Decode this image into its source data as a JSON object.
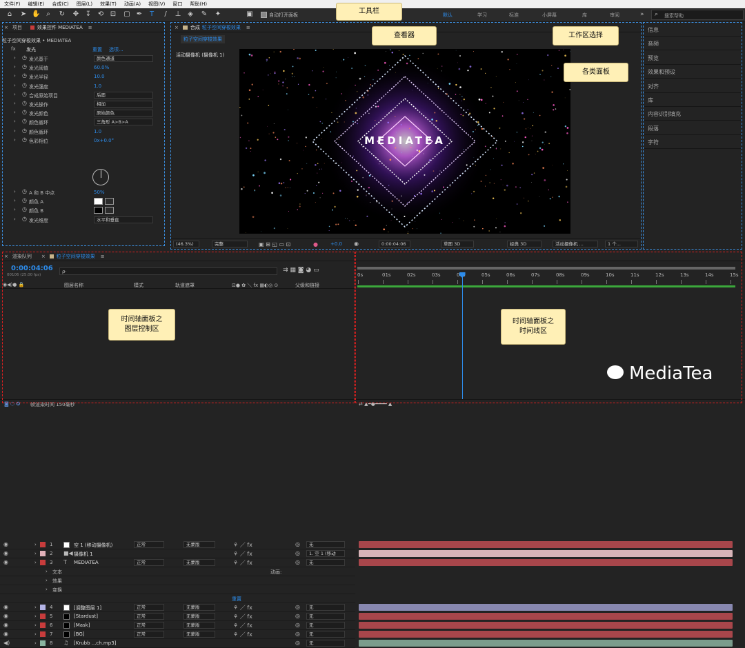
{
  "menu": [
    "文件(F)",
    "编辑(E)",
    "合成(C)",
    "图层(L)",
    "效果(T)",
    "动画(A)",
    "视图(V)",
    "窗口",
    "帮助(H)"
  ],
  "toolbar": {
    "auto_open": "自动打开面板",
    "search_placeholder": "搜索帮助"
  },
  "workspaces": [
    "默认",
    "学习",
    "标准",
    "小屏幕",
    "库",
    "审阅"
  ],
  "workspace_more": "»",
  "callouts": {
    "toolbar": "工具栏",
    "viewer": "查看器",
    "workspace": "工作区选择",
    "panels": "各类面板",
    "layer_ctrl": "时间轴面板之\n图层控制区",
    "timeline": "时间轴面板之\n时间线区"
  },
  "effects": {
    "tab_project": "项目",
    "tab_effects": "效果控件 MEDIATEA",
    "breadcrumb": "粒子空间穿梭效果 • MEDIATEA",
    "glow": {
      "name": "发光",
      "reset": "重置",
      "options": "选项..."
    },
    "rows": [
      {
        "label": "发光基于",
        "value": "颜色通道",
        "kind": "select"
      },
      {
        "label": "发光阈值",
        "value": "60.0%",
        "kind": "num"
      },
      {
        "label": "发光半径",
        "value": "10.0",
        "kind": "num"
      },
      {
        "label": "发光强度",
        "value": "1.0",
        "kind": "num"
      },
      {
        "label": "合成原始项目",
        "value": "后面",
        "kind": "select"
      },
      {
        "label": "发光操作",
        "value": "相加",
        "kind": "select"
      },
      {
        "label": "发光颜色",
        "value": "原始颜色",
        "kind": "select"
      },
      {
        "label": "颜色循环",
        "value": "三角形 A>B>A",
        "kind": "select"
      },
      {
        "label": "颜色循环",
        "value": "1.0",
        "kind": "num"
      },
      {
        "label": "色彩相位",
        "value": "0x+0.0°",
        "kind": "num"
      }
    ],
    "rows2": [
      {
        "label": "A 和 B 中点",
        "value": "50%",
        "kind": "num"
      },
      {
        "label": "颜色 A",
        "value": "",
        "kind": "swatch-white"
      },
      {
        "label": "颜色 B",
        "value": "",
        "kind": "swatch-black"
      },
      {
        "label": "发光维度",
        "value": "水平和垂直",
        "kind": "select"
      }
    ]
  },
  "viewer": {
    "tab": "合成",
    "comp_name": "粒子空间穿梭效果",
    "breadcrumb": "粒子空间穿梭效果",
    "camera_label": "活动摄像机 (摄像机 1)",
    "center_text": "MEDIATEA",
    "zoom": "(46.3%)",
    "quality": "完整",
    "exposure": "+0.0",
    "timecode": "0:00:04:06",
    "draft": "草图 3D",
    "renderer": "经典 3D",
    "camera": "活动摄像机 ...",
    "views": "1 个..."
  },
  "right_panels": [
    "信息",
    "音频",
    "预览",
    "效果和预设",
    "对齐",
    "库",
    "内容识别填充",
    "段落",
    "字符"
  ],
  "timeline": {
    "tab_render": "渲染队列",
    "tab_comp": "粒子空间穿梭效果",
    "timecode": "0:00:04:06",
    "frames": "00106 (25.00 fps)",
    "search_placeholder": "ρ·",
    "col_name": "图层名称",
    "col_mode": "模式",
    "col_track": "轨道遮罩",
    "col_parent": "父级和链接",
    "ruler": [
      "0s",
      "01s",
      "02s",
      "03s",
      "04s",
      "05s",
      "06s",
      "07s",
      "08s",
      "09s",
      "10s",
      "11s",
      "12s",
      "13s",
      "14s",
      "15s"
    ],
    "playhead_fraction": 0.2806,
    "layers": [
      {
        "num": "1",
        "name": "空 1 (移动摄像机)",
        "mode": "正常",
        "track": "无蒙版",
        "parent": "无",
        "color": "#c83c3c",
        "swatch": "#ffffff",
        "bar": "#a8464b",
        "type": "null"
      },
      {
        "num": "2",
        "name": "摄像机 1",
        "mode": "",
        "track": "",
        "parent": "1. 空 1 (移动",
        "color": "#e0b0b8",
        "swatch": "",
        "bar": "#d8b4b8",
        "type": "camera"
      },
      {
        "num": "3",
        "name": "MEDIATEA",
        "mode": "正常",
        "track": "无蒙版",
        "parent": "无",
        "color": "#c83c3c",
        "swatch": "",
        "bar": "#a8464b",
        "type": "text"
      },
      {
        "num": "4",
        "name": "[调整图层 1]",
        "mode": "正常",
        "track": "无蒙版",
        "parent": "无",
        "color": "#b4b4e6",
        "swatch": "#ffffff",
        "bar": "#8888b0",
        "type": "adj"
      },
      {
        "num": "5",
        "name": "[Stardust]",
        "mode": "正常",
        "track": "无蒙版",
        "parent": "无",
        "color": "#c83c3c",
        "swatch": "#000000",
        "bar": "#a8464b",
        "type": "solid"
      },
      {
        "num": "6",
        "name": "[Mask]",
        "mode": "正常",
        "track": "无蒙版",
        "parent": "无",
        "color": "#c83c3c",
        "swatch": "#000000",
        "bar": "#a8464b",
        "type": "solid"
      },
      {
        "num": "7",
        "name": "[BG]",
        "mode": "正常",
        "track": "无蒙版",
        "parent": "无",
        "color": "#c83c3c",
        "swatch": "#000000",
        "bar": "#a8464b",
        "type": "solid"
      },
      {
        "num": "8",
        "name": "[Krubb ...ch.mp3]",
        "mode": "",
        "track": "",
        "parent": "无",
        "color": "#8ab4a0",
        "swatch": "",
        "bar": "#7b9c8c",
        "type": "audio"
      }
    ],
    "sub": [
      "文本",
      "效果",
      "变换"
    ],
    "animate": "动画:",
    "reset": "重置",
    "footer": "帧渲染时间  150毫秒"
  },
  "watermark": "MediaTea"
}
